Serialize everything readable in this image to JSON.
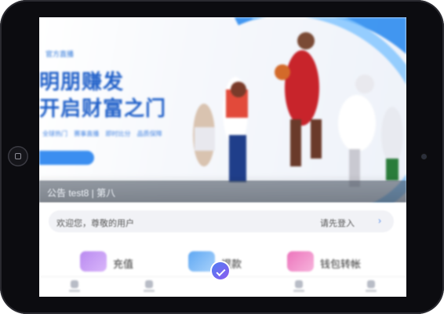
{
  "banner": {
    "tag": "官方直播",
    "headline_line1": "明朋赚发",
    "headline_line2": "开启财富之门",
    "subtitle": "全球热门 赛事直播 即时比分 品质保障",
    "cta_label": ""
  },
  "notice": {
    "text": "公告  test8 | 第八"
  },
  "login": {
    "welcome": "欢迎您，尊敬的用户",
    "login_link": "请先登入",
    "chevron": "›"
  },
  "quick_actions": [
    {
      "label": "充值",
      "color": "#c69cf2"
    },
    {
      "label": "提款",
      "color": "#7ab6f5"
    },
    {
      "label": "钱包转帐",
      "color": "#f08fc8"
    }
  ],
  "colors": {
    "accent": "#2f8df0",
    "bezel": "#0c0c10"
  }
}
